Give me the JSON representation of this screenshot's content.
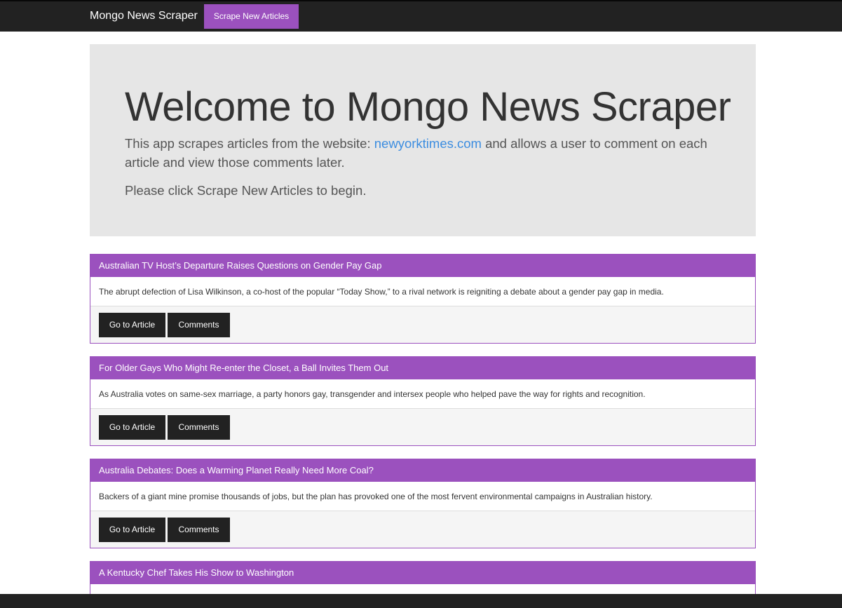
{
  "navbar": {
    "brand": "Mongo News Scraper",
    "scrape_button": "Scrape New Articles"
  },
  "jumbotron": {
    "title": "Welcome to Mongo News Scraper",
    "text_before_link": "This app scrapes articles from the website: ",
    "link_text": "newyorktimes.com",
    "text_after_link": " and allows a user to comment on each article and view those comments later.",
    "instruction": "Please click Scrape New Articles to begin."
  },
  "articles": [
    {
      "title": "Australian TV Host’s Departure Raises Questions on Gender Pay Gap",
      "summary": "The abrupt defection of Lisa Wilkinson, a co-host of the popular “Today Show,” to a rival network is reigniting a debate about a gender pay gap in media.",
      "goto_label": "Go to Article",
      "comments_label": "Comments"
    },
    {
      "title": "For Older Gays Who Might Re-enter the Closet, a Ball Invites Them Out",
      "summary": "As Australia votes on same-sex marriage, a party honors gay, transgender and intersex people who helped pave the way for rights and recognition.",
      "goto_label": "Go to Article",
      "comments_label": "Comments"
    },
    {
      "title": "Australia Debates: Does a Warming Planet Really Need More Coal?",
      "summary": "Backers of a giant mine promise thousands of jobs, but the plan has provoked one of the most fervent environmental campaigns in Australian history.",
      "goto_label": "Go to Article",
      "comments_label": "Comments"
    },
    {
      "title": "A Kentucky Chef Takes His Show to Washington",
      "summary": "",
      "goto_label": "",
      "comments_label": ""
    }
  ],
  "colors": {
    "accent": "#9b51be",
    "navbar": "#222222",
    "jumbotron": "#e6e6e6",
    "link": "#3c8de0"
  }
}
